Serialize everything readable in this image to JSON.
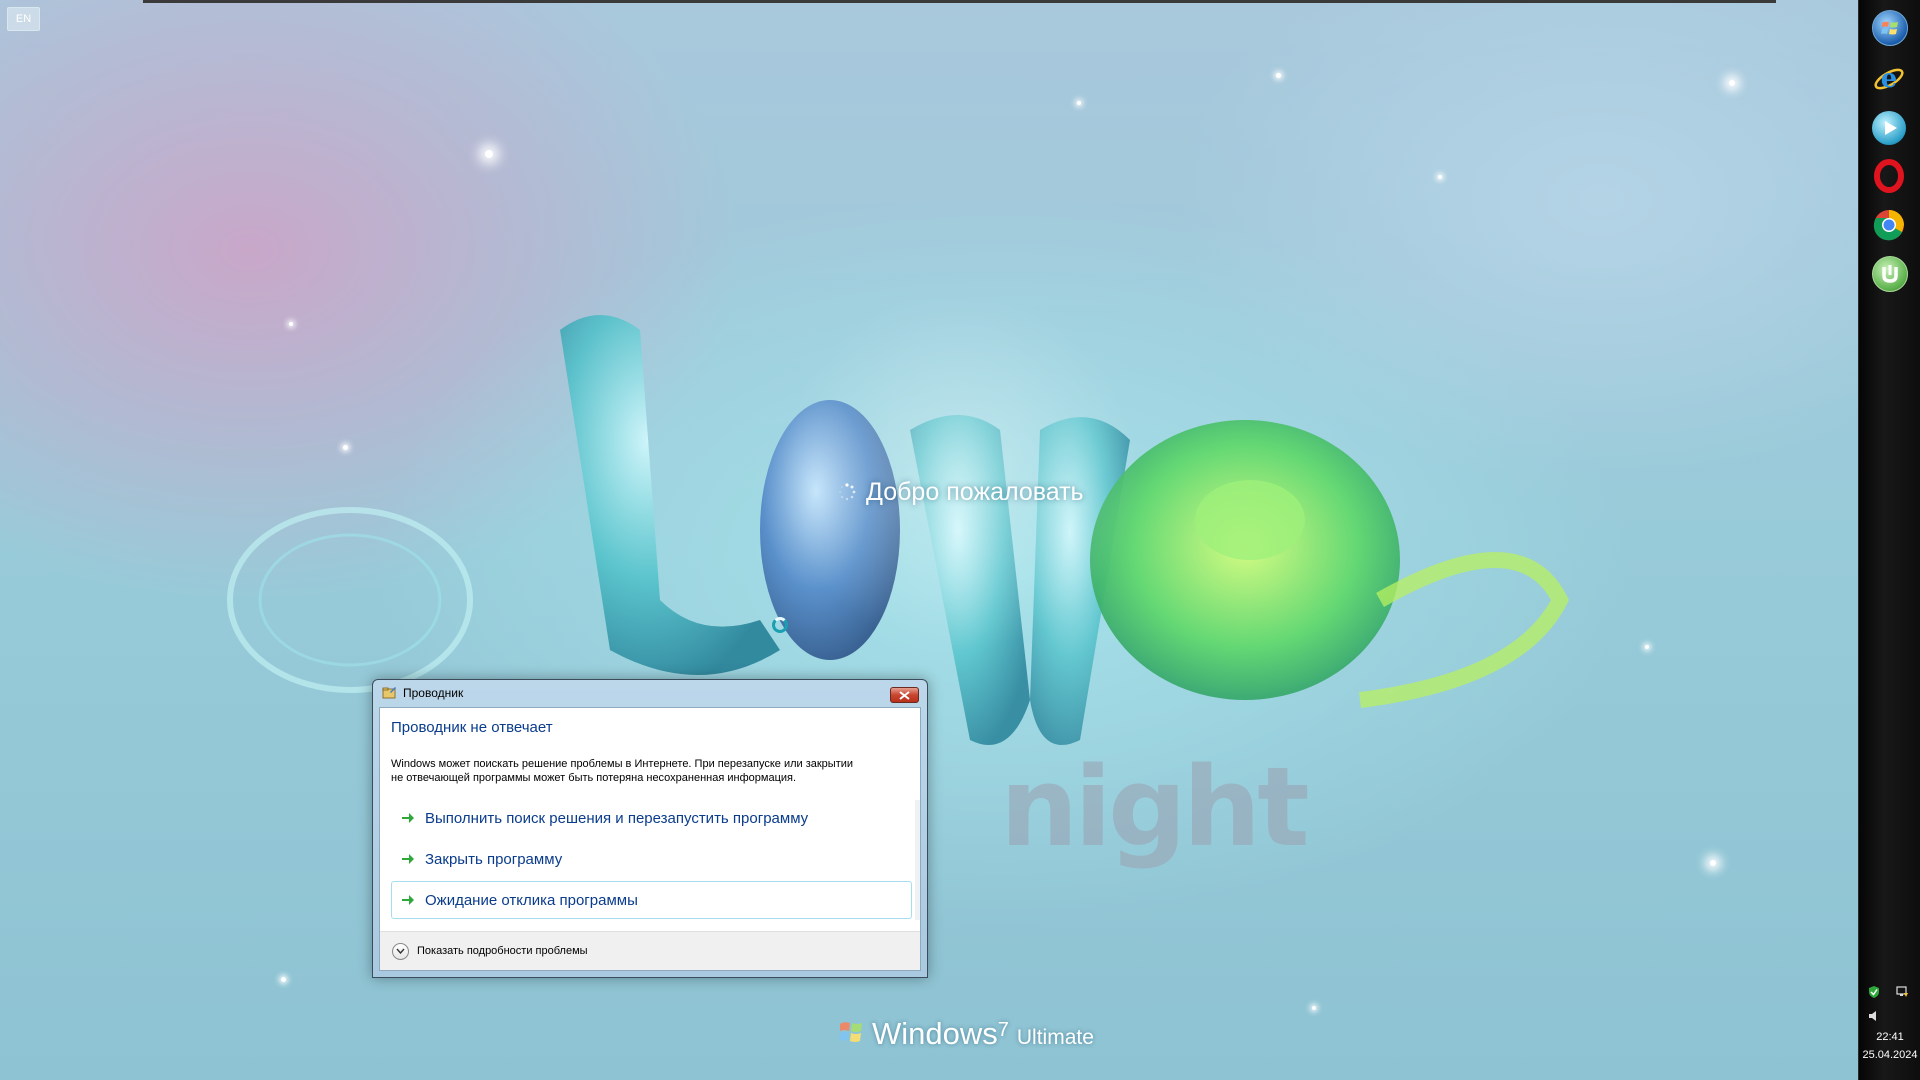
{
  "desktop": {
    "language_indicator": "EN",
    "welcome_text": "Добро пожаловать",
    "branding": {
      "product": "Windows",
      "version": "7",
      "edition": "Ultimate"
    }
  },
  "dialog": {
    "title": "Проводник",
    "main_instruction": "Проводник не отвечает",
    "description_line1": "Windows может поискать решение проблемы в Интернете. При перезапуске или закрытии",
    "description_line2": "не отвечающей программы может быть потеряна несохраненная информация.",
    "commands": [
      {
        "label": "Выполнить поиск решения и перезапустить программу"
      },
      {
        "label": "Закрыть программу"
      },
      {
        "label": "Ожидание отклика программы"
      }
    ],
    "footer_label": "Показать подробности проблемы"
  },
  "taskbar": {
    "icons": [
      "start-orb-icon",
      "internet-explorer-icon",
      "media-player-icon",
      "opera-icon",
      "chrome-icon",
      "utorrent-icon"
    ],
    "clock_time": "22:41",
    "clock_date": "25.04.2024"
  },
  "colors": {
    "link_blue": "#0a3c8c",
    "command_hover_border": "#a8dcef",
    "taskbar_bg": "#0d0d0d"
  }
}
